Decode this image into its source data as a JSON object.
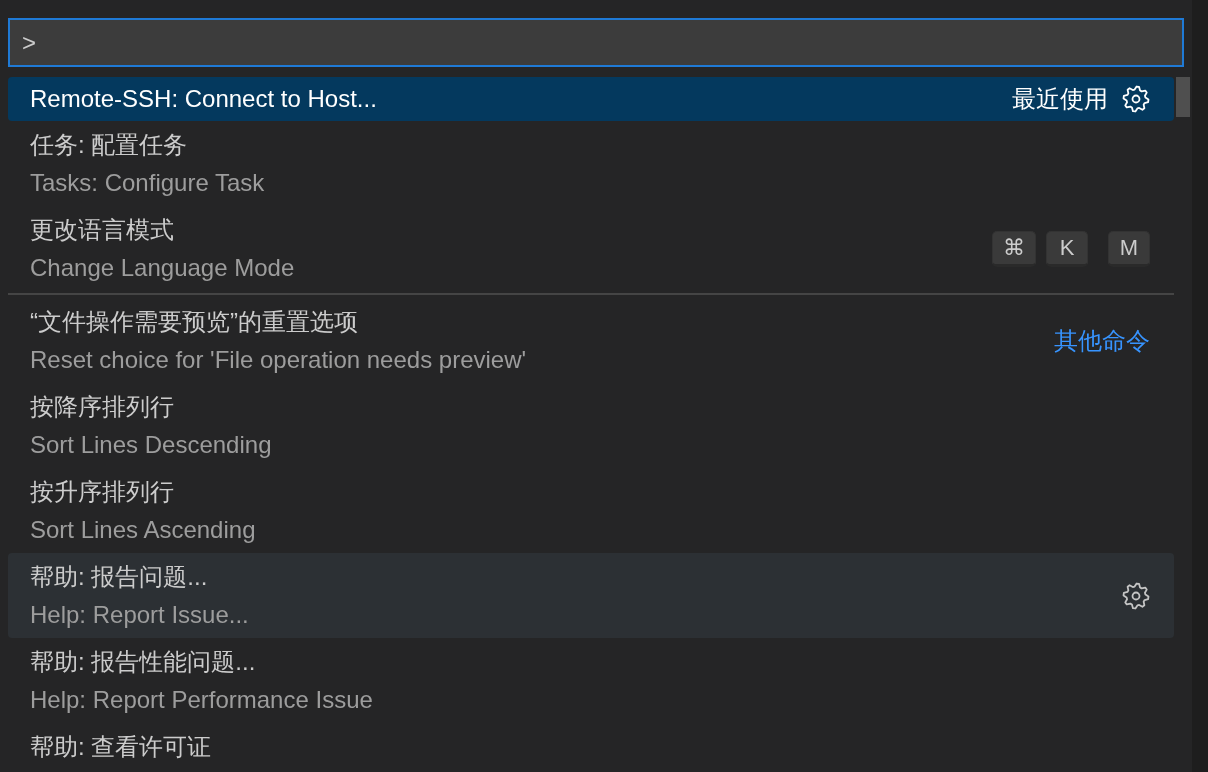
{
  "command_input": {
    "value": ">"
  },
  "items": [
    {
      "label": "Remote-SSH: Connect to Host...",
      "selected": true,
      "hovered": false,
      "separator_before": false,
      "badge": {
        "text": "最近使用",
        "kind": "plain"
      },
      "gear": true
    },
    {
      "label": "任务: 配置任务",
      "detail": "Tasks: Configure Task",
      "selected": false,
      "hovered": false,
      "separator_before": false,
      "gear": false
    },
    {
      "label": "更改语言模式",
      "detail": "Change Language Mode",
      "selected": false,
      "hovered": false,
      "separator_before": false,
      "gear": false,
      "keybinding": [
        {
          "keys": [
            "⌘",
            "K"
          ]
        },
        {
          "keys": [
            "M"
          ]
        }
      ]
    },
    {
      "label": "“文件操作需要预览”的重置选项",
      "detail": "Reset choice for 'File operation needs preview'",
      "selected": false,
      "hovered": false,
      "separator_before": true,
      "badge": {
        "text": "其他命令",
        "kind": "link"
      },
      "gear": false
    },
    {
      "label": "按降序排列行",
      "detail": "Sort Lines Descending",
      "selected": false,
      "hovered": false,
      "separator_before": false,
      "gear": false
    },
    {
      "label": "按升序排列行",
      "detail": "Sort Lines Ascending",
      "selected": false,
      "hovered": false,
      "separator_before": false,
      "gear": false
    },
    {
      "label": "帮助: 报告问题...",
      "detail": "Help: Report Issue...",
      "selected": false,
      "hovered": true,
      "separator_before": false,
      "gear": true
    },
    {
      "label": "帮助: 报告性能问题...",
      "detail": "Help: Report Performance Issue",
      "selected": false,
      "hovered": false,
      "separator_before": false,
      "gear": false
    },
    {
      "label": "帮助: 查看许可证",
      "selected": false,
      "hovered": false,
      "separator_before": false,
      "gear": false
    }
  ]
}
